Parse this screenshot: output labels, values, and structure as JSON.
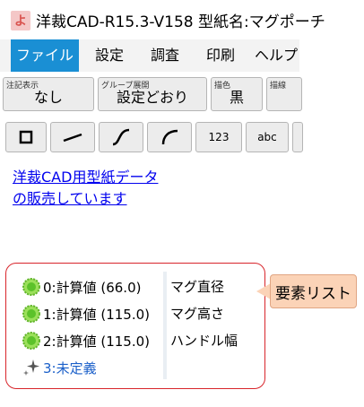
{
  "titlebar": {
    "app_icon": "よ",
    "title": "洋裁CAD-R15.3-V158 型紙名:マグポーチ"
  },
  "menu": {
    "items": [
      {
        "label": "ファイル",
        "active": true
      },
      {
        "label": "設定"
      },
      {
        "label": "調査"
      },
      {
        "label": "印刷"
      },
      {
        "label": "ヘルプ"
      }
    ]
  },
  "toolbar": {
    "row1": [
      {
        "small": "注記表示",
        "big": "なし"
      },
      {
        "small": "グループ展開",
        "big": "設定どおり"
      },
      {
        "small": "描色",
        "big": "黒"
      },
      {
        "small": "描線",
        "big": ""
      }
    ],
    "row2": [
      {
        "name": "square",
        "label": "",
        "icon": "square-icon"
      },
      {
        "name": "line",
        "label": "",
        "icon": "line-icon"
      },
      {
        "name": "curve",
        "label": "",
        "icon": "s-curve-icon"
      },
      {
        "name": "arc",
        "label": "",
        "icon": "arc-icon"
      },
      {
        "name": "number",
        "label": "123"
      },
      {
        "name": "text",
        "label": "abc"
      }
    ]
  },
  "ad": {
    "line1": "洋裁CAD用型紙データ",
    "line2": "の販売しています"
  },
  "elements": {
    "rows": [
      {
        "value": "0:計算値 (66.0)",
        "name": "マグ直径",
        "icon": "green-circle-icon"
      },
      {
        "value": "1:計算値 (115.0)",
        "name": "マグ高さ",
        "icon": "green-circle-icon"
      },
      {
        "value": "2:計算値 (115.0)",
        "name": "ハンドル幅",
        "icon": "green-circle-icon"
      },
      {
        "value": "3:未定義",
        "name": "",
        "icon": "sparkle-icon"
      }
    ]
  },
  "callout": {
    "label": "要素リスト"
  },
  "colors": {
    "accent": "#1a8fd4",
    "highlight_border": "#d8252b",
    "callout_fill": "#fbd3b7",
    "link": "#0000ee"
  }
}
